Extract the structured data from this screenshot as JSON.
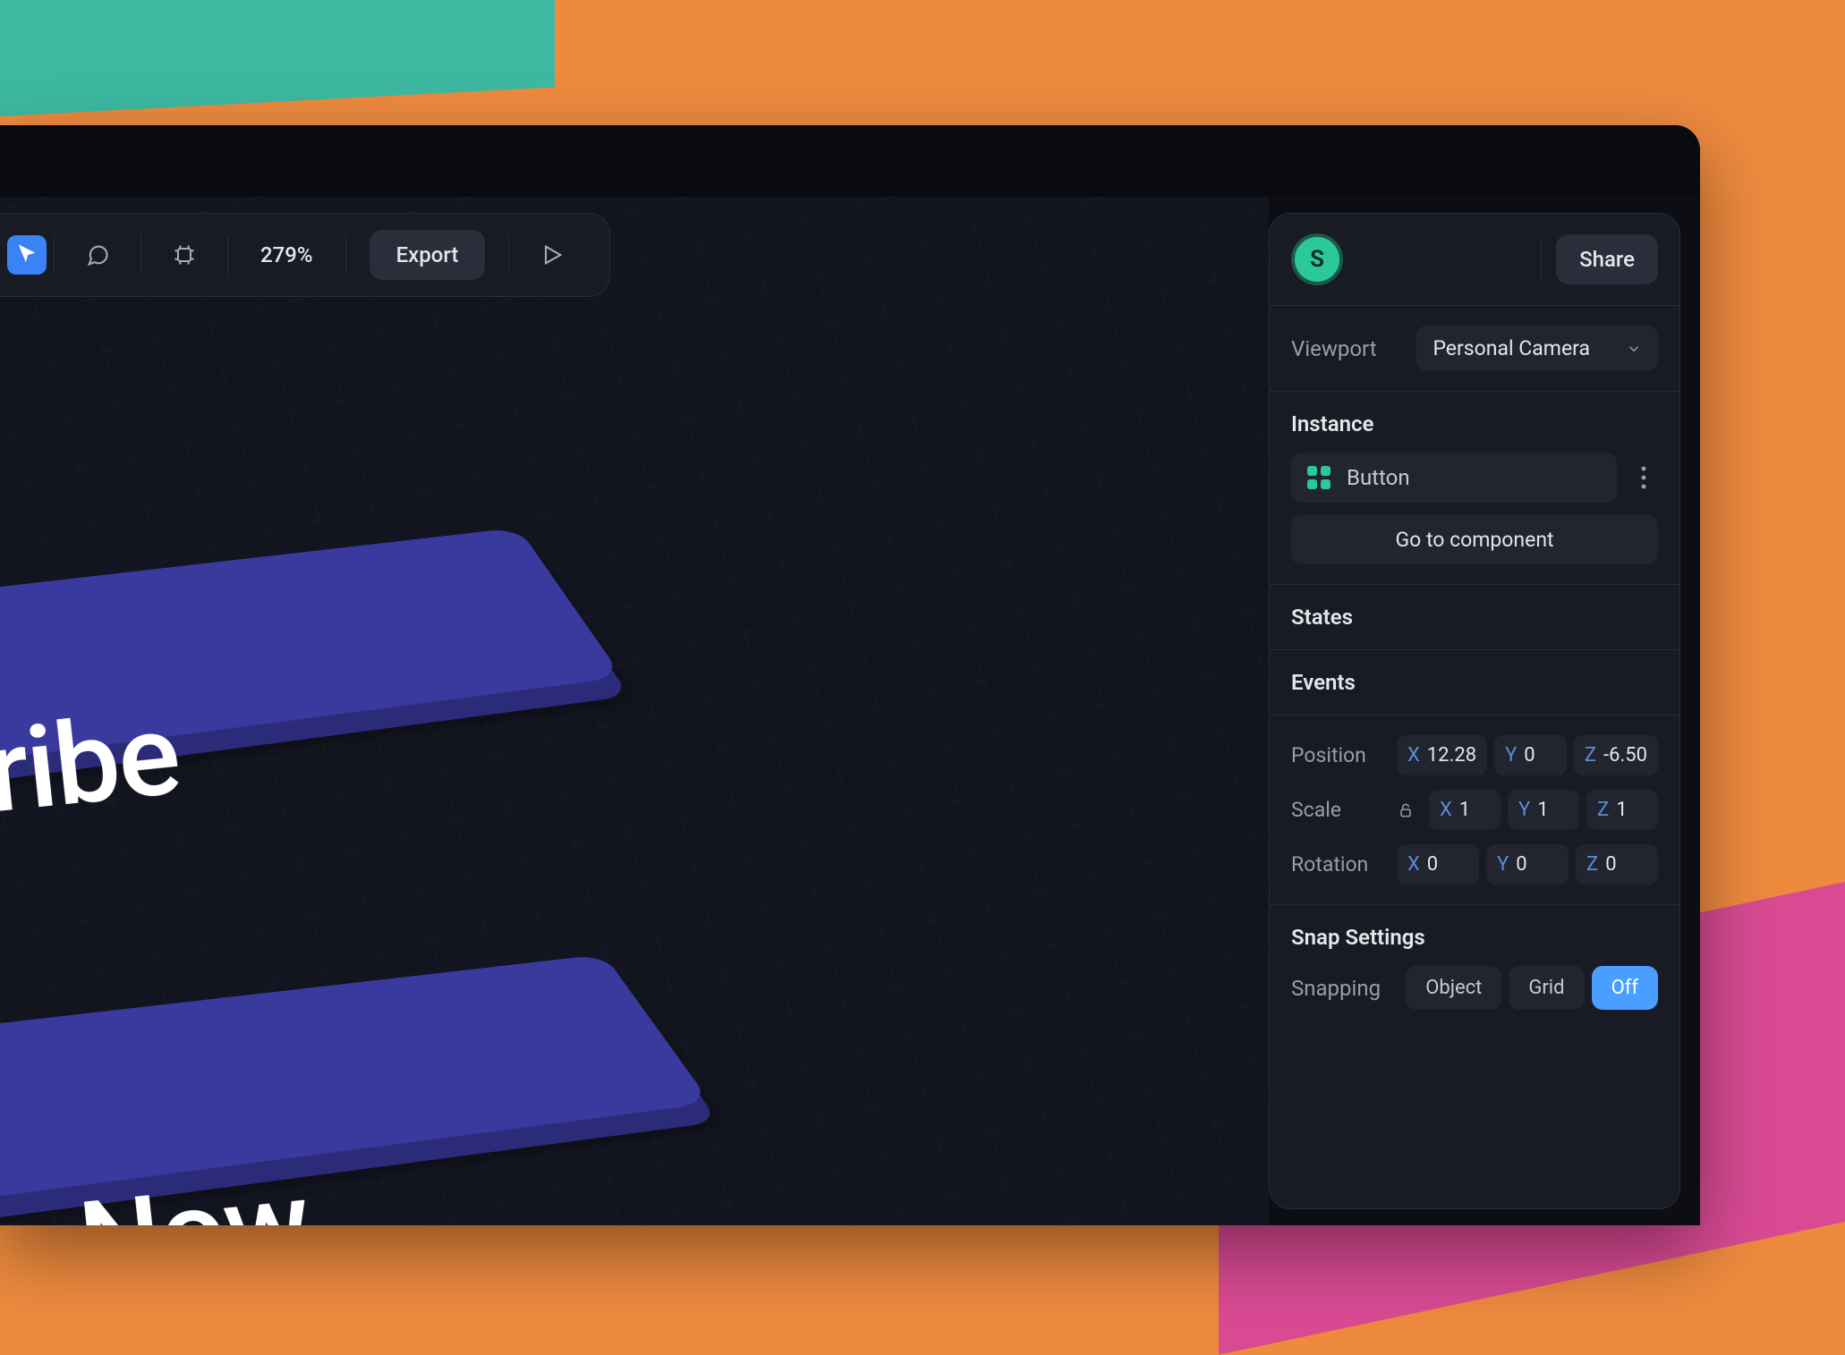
{
  "toolbar": {
    "zoom": "279%",
    "export_label": "Export"
  },
  "canvas": {
    "text_1": "cribe",
    "text_2": "de Now"
  },
  "sidebar": {
    "avatar_letter": "S",
    "share_label": "Share",
    "viewport": {
      "label": "Viewport",
      "value": "Personal Camera"
    },
    "instance": {
      "heading": "Instance",
      "name": "Button",
      "goto_label": "Go to component"
    },
    "states_heading": "States",
    "events_heading": "Events",
    "transform": {
      "position": {
        "label": "Position",
        "x": "12.28",
        "y": "0",
        "z": "-6.50"
      },
      "scale": {
        "label": "Scale",
        "x": "1",
        "y": "1",
        "z": "1"
      },
      "rotation": {
        "label": "Rotation",
        "x": "0",
        "y": "0",
        "z": "0"
      }
    },
    "snap": {
      "heading": "Snap Settings",
      "label": "Snapping",
      "options": [
        "Object",
        "Grid",
        "Off"
      ],
      "active": "Off"
    }
  }
}
